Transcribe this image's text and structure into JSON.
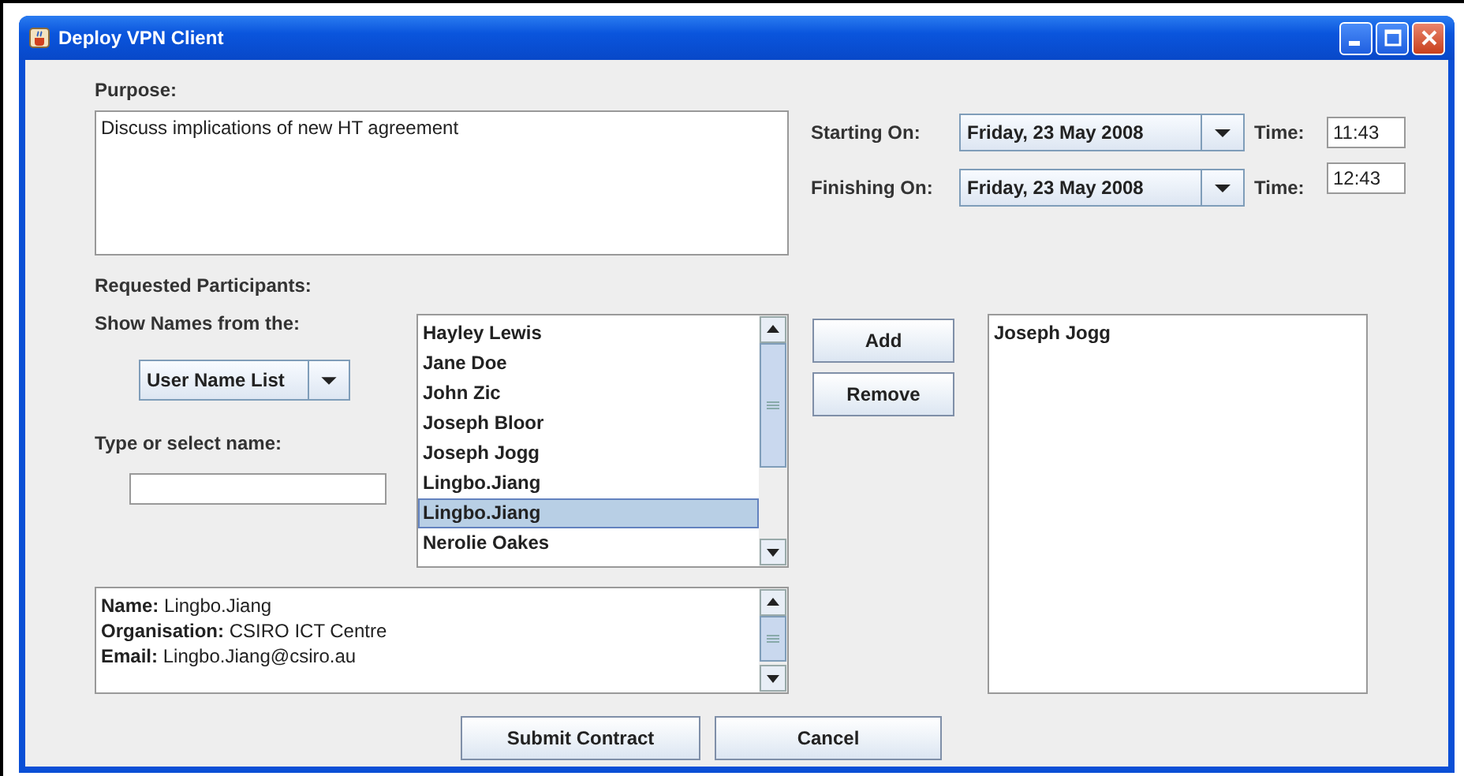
{
  "window": {
    "title": "Deploy VPN Client"
  },
  "purpose": {
    "label": "Purpose:",
    "value": "Discuss implications of new HT agreement"
  },
  "schedule": [
    {
      "label": "Starting On:",
      "date": "Friday, 23 May 2008",
      "time_label": "Time:",
      "time": "11:43"
    },
    {
      "label": "Finishing On:",
      "date": "Friday, 23 May 2008",
      "time_label": "Time:",
      "time": "12:43"
    }
  ],
  "participants": {
    "label": "Requested Participants:",
    "source_label": "Show Names from the:",
    "source": "User Name List",
    "name_label": "Type or select name:",
    "names": [
      {
        "text": "Hayley Lewis",
        "selected": false
      },
      {
        "text": "Jane Doe",
        "selected": false
      },
      {
        "text": "John Zic",
        "selected": false
      },
      {
        "text": "Joseph Bloor",
        "selected": false
      },
      {
        "text": "Joseph Jogg",
        "selected": false
      },
      {
        "text": "Lingbo.Jiang",
        "selected": false
      },
      {
        "text": "Lingbo.Jiang",
        "selected": true
      },
      {
        "text": "Nerolie Oakes",
        "selected": false
      }
    ],
    "actions": [
      "Add",
      "Remove"
    ],
    "chosen": [
      "Joseph Jogg"
    ],
    "details": [
      "**Name:** Lingbo.Jiang",
      "**Organisation:** CSIRO ICT Centre",
      "**Email:** Lingbo.Jiang@csiro.au"
    ]
  },
  "buttons": [
    "Submit Contract",
    "Cancel"
  ]
}
